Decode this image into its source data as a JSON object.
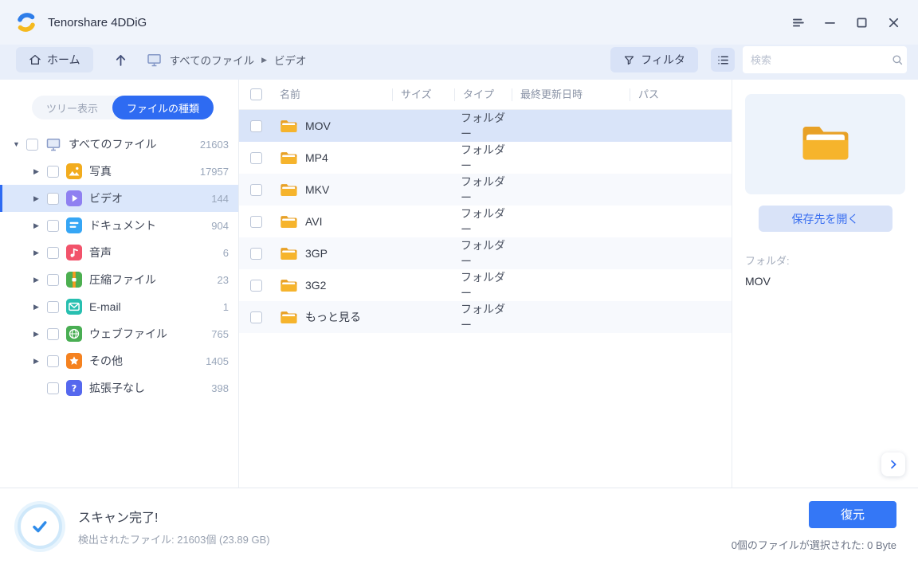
{
  "window": {
    "title": "Tenorshare 4DDiG",
    "controls": {
      "menu": "menu",
      "minimize": "minimize",
      "maximize": "maximize",
      "close": "close"
    }
  },
  "toolbar": {
    "home_label": "ホーム",
    "breadcrumb": {
      "root": "すべてのファイル",
      "separator": "▶",
      "current": "ビデオ"
    },
    "filter_label": "フィルタ",
    "search_placeholder": "検索"
  },
  "sidebar": {
    "tabs": [
      {
        "label": "ツリー表示",
        "active": false
      },
      {
        "label": "ファイルの種類",
        "active": true
      }
    ],
    "selected_item": "ビデオ",
    "items": [
      {
        "label": "すべてのファイル",
        "count": "21603",
        "icon": "monitor-icon",
        "level": 0,
        "expanded": true
      },
      {
        "label": "写真",
        "count": "17957",
        "icon": "photo-icon",
        "color": "#F2AC1E"
      },
      {
        "label": "ビデオ",
        "count": "144",
        "icon": "video-icon",
        "color": "#8F80F1",
        "selected": true
      },
      {
        "label": "ドキュメント",
        "count": "904",
        "icon": "document-icon",
        "color": "#36A6F5"
      },
      {
        "label": "音声",
        "count": "6",
        "icon": "audio-icon",
        "color": "#F2536B"
      },
      {
        "label": "圧縮ファイル",
        "count": "23",
        "icon": "archive-icon",
        "color": "#4CAF50"
      },
      {
        "label": "E-mail",
        "count": "1",
        "icon": "mail-icon",
        "color": "#27BFB0"
      },
      {
        "label": "ウェブファイル",
        "count": "765",
        "icon": "web-icon",
        "color": "#49AE53"
      },
      {
        "label": "その他",
        "count": "1405",
        "icon": "star-icon",
        "color": "#F58220"
      },
      {
        "label": "拡張子なし",
        "count": "398",
        "icon": "question-icon",
        "color": "#5568EE",
        "has_arrow": false
      }
    ]
  },
  "file_list": {
    "columns": [
      "名前",
      "サイズ",
      "タイプ",
      "最終更新日時",
      "パス"
    ],
    "selected_row": "MOV",
    "rows": [
      {
        "name": "MOV",
        "size": "",
        "type": "フォルダー",
        "modified": "",
        "path": "",
        "selected": true
      },
      {
        "name": "MP4",
        "size": "",
        "type": "フォルダー",
        "modified": "",
        "path": ""
      },
      {
        "name": "MKV",
        "size": "",
        "type": "フォルダー",
        "modified": "",
        "path": ""
      },
      {
        "name": "AVI",
        "size": "",
        "type": "フォルダー",
        "modified": "",
        "path": ""
      },
      {
        "name": "3GP",
        "size": "",
        "type": "フォルダー",
        "modified": "",
        "path": ""
      },
      {
        "name": "3G2",
        "size": "",
        "type": "フォルダー",
        "modified": "",
        "path": ""
      },
      {
        "name": "もっと見る",
        "size": "",
        "type": "フォルダー",
        "modified": "",
        "path": ""
      }
    ]
  },
  "preview": {
    "open_button_label": "保存先を開く",
    "folder_label": "フォルダ:",
    "folder_name": "MOV"
  },
  "status_bar": {
    "scan_title": "スキャン完了!",
    "scan_subtitle": "検出されたファイル: 21603個 (23.89 GB)",
    "recover_label": "復元",
    "selection_info": "0個のファイルが選択された:  0 Byte"
  },
  "icons": {
    "app-logo-icon": "two interlocked blue/yellow swoosh arrows",
    "menu-icon": "three horizontal bars",
    "minimize-icon": "−",
    "maximize-icon": "□",
    "close-icon": "×",
    "home-icon": "house outline",
    "up-arrow-icon": "↑",
    "monitor-icon": "desktop display outline",
    "filter-icon": "funnel",
    "list-view-icon": "bulleted list",
    "search-icon": "magnifier",
    "expand-arrow-icon": "▶ / ▼",
    "folder-icon": "orange folder with white sheet",
    "chevron-right-icon": ">",
    "check-icon": "blue checkmark in ringed circle"
  },
  "colors": {
    "accent_blue": "#2E6BF2",
    "recover_button": "#3477F6",
    "titlebar_bg": "#F0F4FB",
    "toolbar_bg": "#E9EFFA",
    "selected_row_bg": "#D9E4F9",
    "sidebar_selected_bg": "#DBE7FB",
    "alt_row_bg": "#F7F9FD",
    "pill_button_bg": "#D8E2F7",
    "preview_card_bg": "#EDF3FB",
    "folder_orange": "#F0A429",
    "link_blue": "#3A6FF0"
  }
}
